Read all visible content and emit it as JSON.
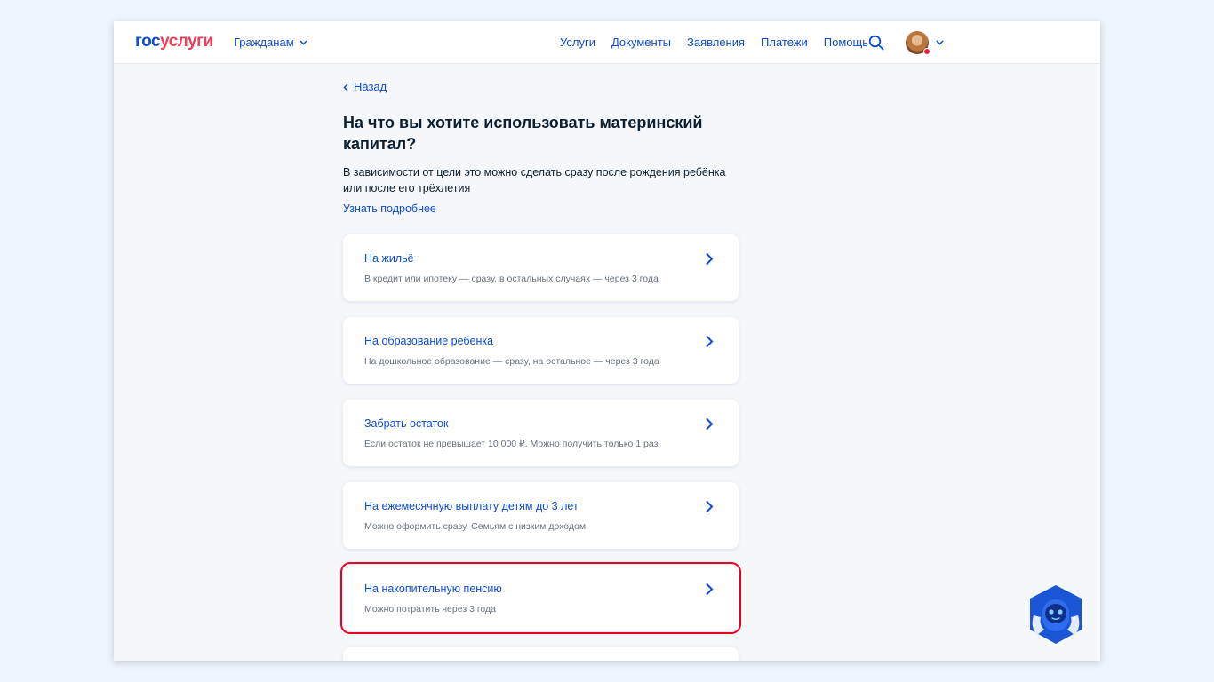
{
  "header": {
    "logo_part1": "гос",
    "logo_part2": "услуги",
    "role_label": "Гражданам",
    "nav": [
      "Услуги",
      "Документы",
      "Заявления",
      "Платежи",
      "Помощь"
    ]
  },
  "content": {
    "back_label": "Назад",
    "title": "На что вы хотите использовать материнский капитал?",
    "description": "В зависимости от цели это можно сделать сразу после рождения ребёнка или после его трёхлетия",
    "more_link": "Узнать подробнее"
  },
  "options": [
    {
      "title": "На жильё",
      "subtitle": "В кредит или ипотеку — сразу, в остальных случаях — через 3 года"
    },
    {
      "title": "На образование ребёнка",
      "subtitle": "На дошкольное образование — сразу, на остальное — через 3 года"
    },
    {
      "title": "Забрать остаток",
      "subtitle": "Если остаток не превышает 10 000 ₽. Можно получить только 1 раз"
    },
    {
      "title": "На ежемесячную выплату детям до 3 лет",
      "subtitle": "Можно оформить сразу. Семьям с низким доходом"
    },
    {
      "title": "На накопительную пенсию",
      "subtitle": "Можно потратить через 3 года"
    }
  ],
  "icons": {
    "chevron": "chevron-right-icon",
    "search": "search-icon",
    "assistant": "robot-assistant-icon"
  },
  "colors": {
    "brand_blue": "#0d4cd3",
    "brand_red": "#ee3f58",
    "highlight": "#e8001d",
    "background": "#eef4fc"
  }
}
